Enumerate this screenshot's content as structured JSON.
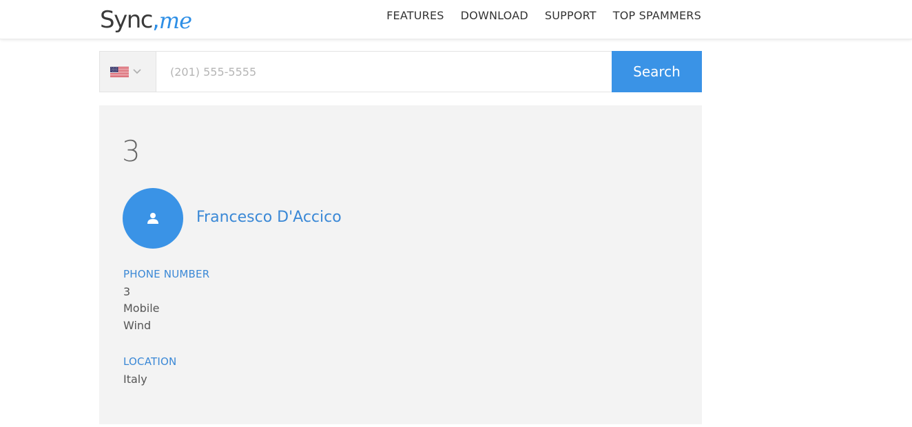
{
  "header": {
    "logo": {
      "sync": "Sync",
      "comma": ",",
      "me": "me"
    },
    "nav": [
      {
        "label": "FEATURES"
      },
      {
        "label": "DOWNLOAD"
      },
      {
        "label": "SUPPORT"
      },
      {
        "label": "TOP SPAMMERS"
      }
    ]
  },
  "search": {
    "country_flag": "us-flag-icon",
    "input_value": "",
    "placeholder": "(201) 555-5555",
    "button_label": "Search"
  },
  "result": {
    "number": "3",
    "avatar_icon": "user-icon",
    "name": "Francesco D'Accico",
    "phone_section": {
      "label": "PHONE NUMBER",
      "number": "3",
      "type": "Mobile",
      "carrier": "Wind"
    },
    "location_section": {
      "label": "LOCATION",
      "value": "Italy"
    }
  },
  "colors": {
    "accent": "#3a93e6",
    "link": "#3a88d6",
    "card_bg": "#f3f3f3",
    "text": "#555555"
  }
}
